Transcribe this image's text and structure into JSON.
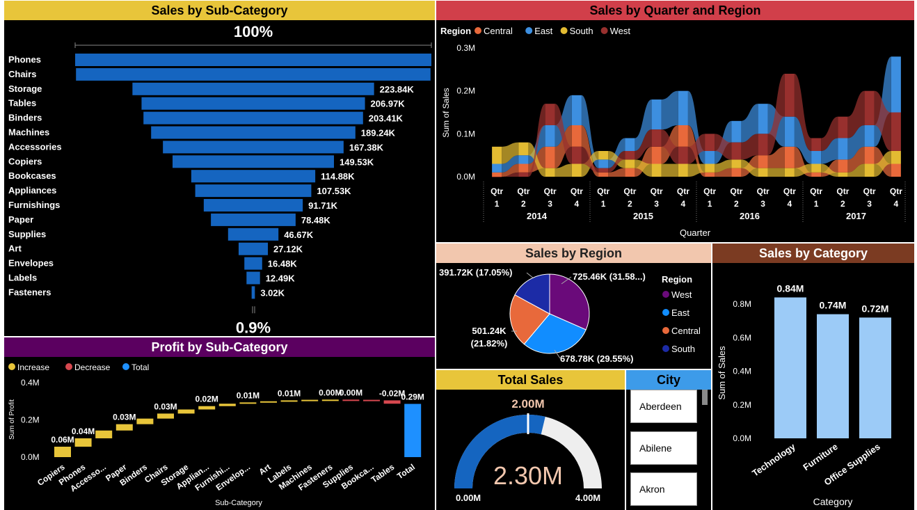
{
  "colors": {
    "blue": "#1565c0",
    "bright_blue": "#1e90ff",
    "gold": "#e8c53a",
    "red": "#d13f4a",
    "purple": "#5b0060",
    "peach": "#f2c7ae",
    "brown": "#7b3b22",
    "light_blue": "#9ccbf7"
  },
  "funnel": {
    "title": "Sales by Sub-Category",
    "top_pct": "100%",
    "bottom_pct": "0.9%",
    "chart_data": {
      "type": "funnel",
      "categories": [
        "Phones",
        "Chairs",
        "Storage",
        "Tables",
        "Binders",
        "Machines",
        "Accessories",
        "Copiers",
        "Bookcases",
        "Appliances",
        "Furnishings",
        "Paper",
        "Supplies",
        "Art",
        "Envelopes",
        "Labels",
        "Fasteners"
      ],
      "labels": [
        "",
        "",
        "223.84K",
        "206.97K",
        "203.41K",
        "189.24K",
        "167.38K",
        "149.53K",
        "114.88K",
        "107.53K",
        "91.71K",
        "78.48K",
        "46.67K",
        "27.12K",
        "16.48K",
        "12.49K",
        "3.02K"
      ],
      "values": [
        330.01,
        328.45,
        223.84,
        206.97,
        203.41,
        189.24,
        167.38,
        149.53,
        114.88,
        107.53,
        91.71,
        78.48,
        46.67,
        27.12,
        16.48,
        12.49,
        3.02
      ]
    }
  },
  "ribbon": {
    "title": "Sales by Quarter and Region",
    "legend_title": "Region",
    "ylabel": "Sum of Sales",
    "xlabel": "Quarter",
    "yticks": [
      "0.3M",
      "0.2M",
      "0.1M",
      "0.0M"
    ],
    "years": [
      "2014",
      "2015",
      "2016",
      "2017"
    ],
    "qtr_word": "Qtr",
    "qtr_nums": [
      "1",
      "2",
      "3",
      "4"
    ],
    "chart_data": {
      "type": "ribbon",
      "x": [
        "2014 Q1",
        "2014 Q2",
        "2014 Q3",
        "2014 Q4",
        "2015 Q1",
        "2015 Q2",
        "2015 Q3",
        "2015 Q4",
        "2016 Q1",
        "2016 Q2",
        "2016 Q3",
        "2016 Q4",
        "2017 Q1",
        "2017 Q2",
        "2017 Q3",
        "2017 Q4"
      ],
      "ylim": [
        0,
        0.3
      ],
      "series": [
        {
          "name": "Central",
          "color": "#e8693b",
          "values": [
            0.01,
            0.02,
            0.05,
            0.05,
            0.01,
            0.02,
            0.04,
            0.05,
            0.01,
            0.02,
            0.03,
            0.05,
            0.01,
            0.03,
            0.04,
            0.03
          ]
        },
        {
          "name": "East",
          "color": "#3d8fe0",
          "values": [
            0.02,
            0.02,
            0.05,
            0.07,
            0.02,
            0.03,
            0.07,
            0.08,
            0.03,
            0.05,
            0.07,
            0.07,
            0.03,
            0.05,
            0.05,
            0.13
          ]
        },
        {
          "name": "South",
          "color": "#e3bb32",
          "values": [
            0.04,
            0.03,
            0.02,
            0.03,
            0.02,
            0.02,
            0.03,
            0.03,
            0.02,
            0.02,
            0.02,
            0.02,
            0.02,
            0.01,
            0.03,
            0.03
          ]
        },
        {
          "name": "West",
          "color": "#98302e",
          "values": [
            0.0,
            0.01,
            0.05,
            0.04,
            0.01,
            0.02,
            0.04,
            0.04,
            0.04,
            0.04,
            0.05,
            0.1,
            0.03,
            0.05,
            0.08,
            0.09
          ]
        }
      ]
    }
  },
  "pie": {
    "title": "Sales by Region",
    "legend_title": "Region",
    "chart_data": {
      "type": "pie",
      "series": [
        {
          "name": "West",
          "value": 725.46,
          "label": "725.46K (31.58...)",
          "color": "#6a0a7a"
        },
        {
          "name": "East",
          "value": 678.78,
          "label": "678.78K (29.55%)",
          "color": "#118dff"
        },
        {
          "name": "Central",
          "value": 501.24,
          "label_line1": "501.24K",
          "label_line2": "(21.82%)",
          "color": "#e8693b"
        },
        {
          "name": "South",
          "value": 391.72,
          "label": "391.72K (17.05%)",
          "color": "#1c2ba6"
        }
      ]
    }
  },
  "category": {
    "title": "Sales by Category",
    "ylabel": "Sum of Sales",
    "xlabel": "Category",
    "yticks": [
      "0.8M",
      "0.6M",
      "0.4M",
      "0.2M",
      "0.0M"
    ],
    "chart_data": {
      "type": "bar",
      "categories": [
        "Technology",
        "Furniture",
        "Office Supplies"
      ],
      "values": [
        0.84,
        0.74,
        0.72
      ],
      "labels": [
        "0.84M",
        "0.74M",
        "0.72M"
      ],
      "ylim": [
        0,
        0.9
      ]
    }
  },
  "profit": {
    "title": "Profit by Sub-Category",
    "legend": [
      {
        "name": "Increase",
        "color": "#e8c53a"
      },
      {
        "name": "Decrease",
        "color": "#d6484f"
      },
      {
        "name": "Total",
        "color": "#1e90ff"
      }
    ],
    "ylabel": "Sum of Profit",
    "xlabel": "Sub-Category",
    "yticks": [
      "0.4M",
      "0.2M",
      "0.0M"
    ],
    "chart_data": {
      "type": "waterfall",
      "categories": [
        "Copiers",
        "Phones",
        "Accesso...",
        "Paper",
        "Binders",
        "Chairs",
        "Storage",
        "Applian...",
        "Furnishi...",
        "Envelop...",
        "Art",
        "Labels",
        "Machines",
        "Fasteners",
        "Supplies",
        "Bookca...",
        "Tables",
        "Total"
      ],
      "values": [
        0.056,
        0.045,
        0.042,
        0.034,
        0.03,
        0.027,
        0.022,
        0.018,
        0.013,
        0.007,
        0.006,
        0.005,
        0.003,
        0.001,
        -0.001,
        -0.003,
        -0.018,
        0.286
      ],
      "labels": [
        "0.06M",
        "0.04M",
        "",
        "0.03M",
        "",
        "0.03M",
        "",
        "0.02M",
        "",
        "0.01M",
        "",
        "0.01M",
        "",
        "0.00M",
        "0.00M",
        "",
        "-0.02M",
        "0.29M"
      ],
      "ylim": [
        0,
        0.4
      ]
    }
  },
  "gauge": {
    "title": "Total Sales",
    "value_label": "2.30M",
    "target_label": "2.00M",
    "min_label": "0.00M",
    "max_label": "4.00M",
    "chart_data": {
      "type": "gauge",
      "value": 2.3,
      "target": 2.0,
      "min": 0,
      "max": 4.0
    }
  },
  "city": {
    "title": "City",
    "items": [
      "Aberdeen",
      "Abilene",
      "Akron"
    ]
  }
}
